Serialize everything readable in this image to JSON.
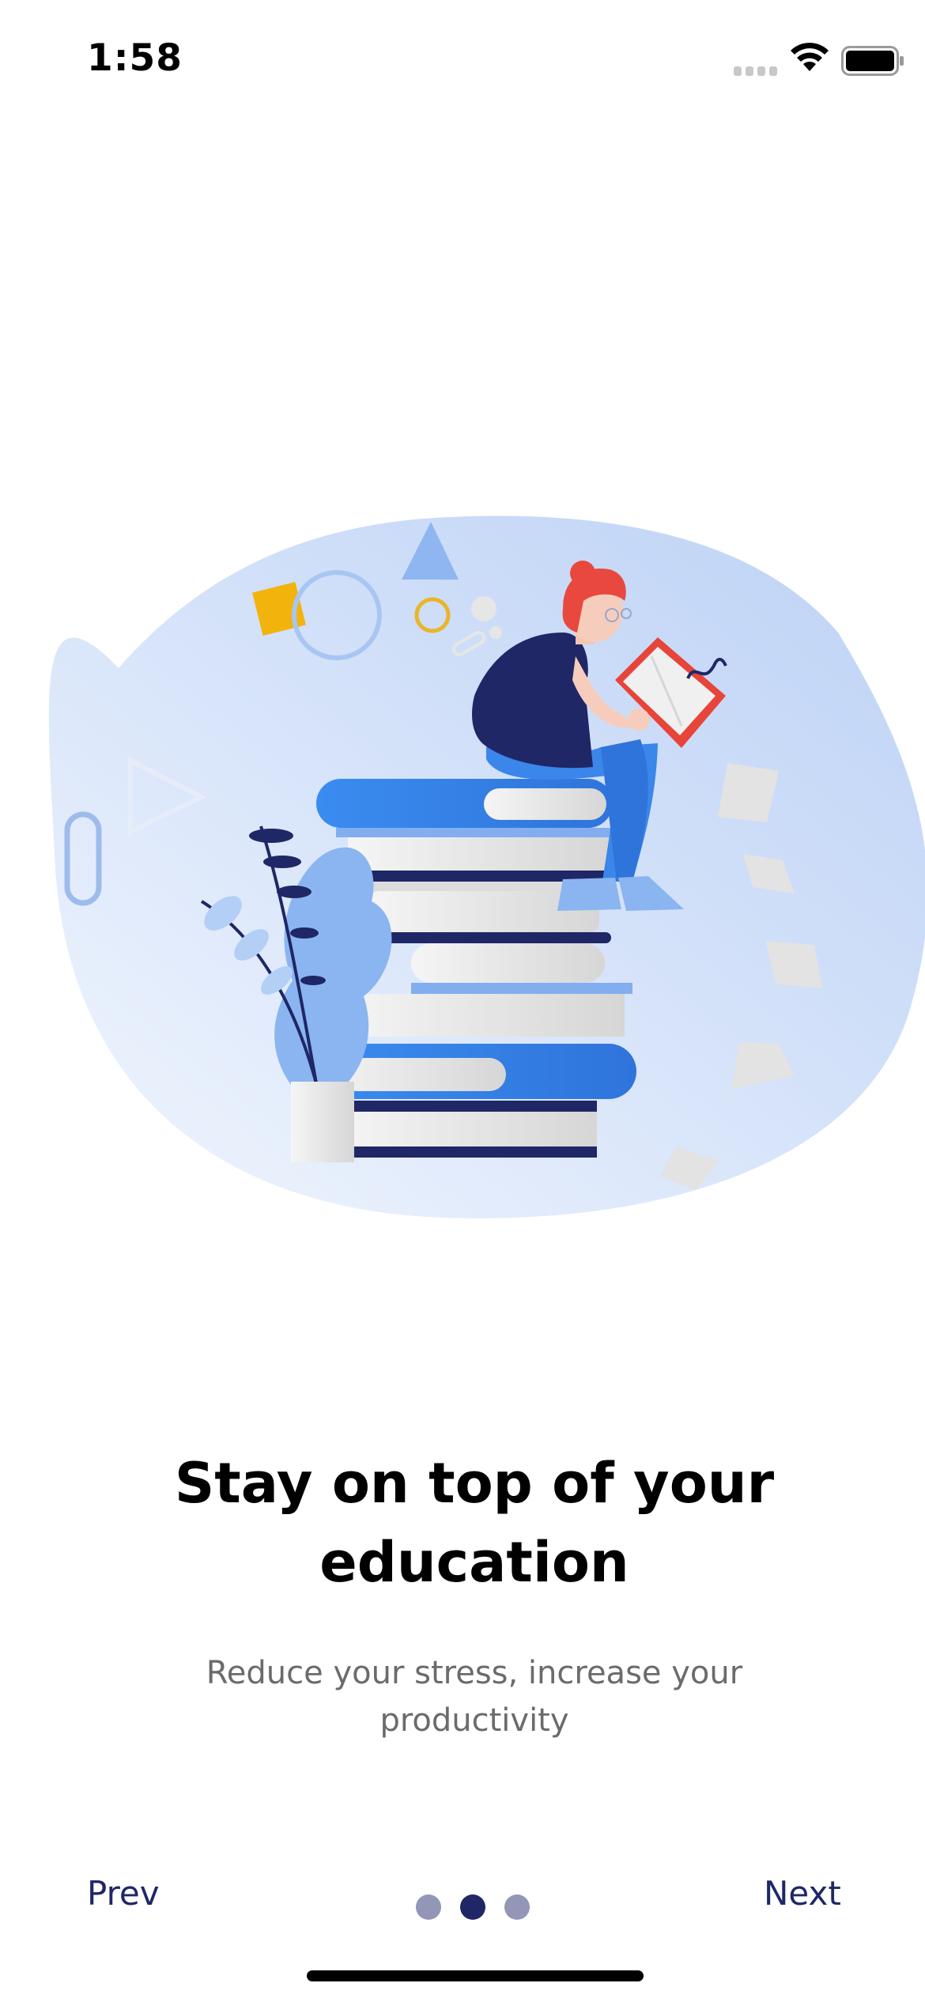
{
  "status_bar": {
    "time": "1:58"
  },
  "onboarding": {
    "illustration_name": "student-reading-on-books",
    "title_line1": "Stay on top of your",
    "title_line2": "education",
    "subtitle_line1": "Reduce your stress, increase your",
    "subtitle_line2": "productivity",
    "page_total": 3,
    "page_current": 2
  },
  "navigation": {
    "prev_label": "Prev",
    "next_label": "Next"
  },
  "colors": {
    "accent": "#1f2766",
    "dot_inactive": "#9496b8",
    "blob": "#c9dbf7",
    "book_blue": "#3283e6",
    "hair": "#e9483e"
  }
}
